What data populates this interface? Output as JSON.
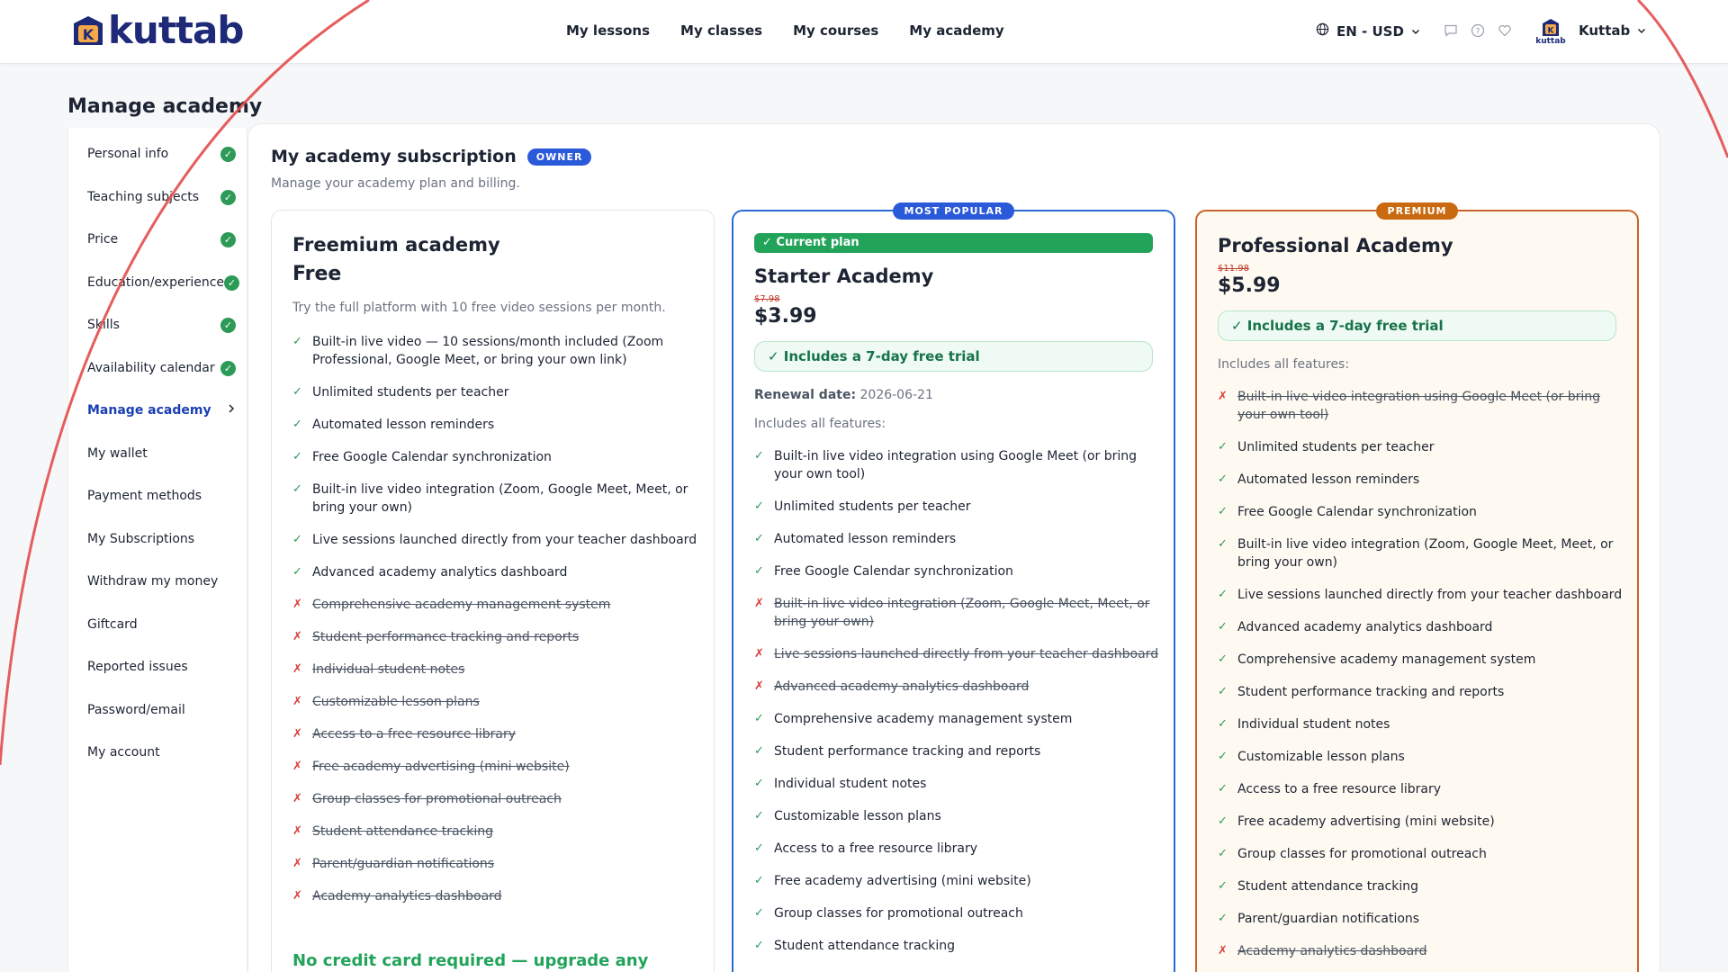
{
  "header": {
    "brand": "kuttab",
    "nav": [
      "My lessons",
      "My classes",
      "My courses",
      "My academy"
    ],
    "locale": "EN - USD",
    "avatar_label": "kuttab",
    "user_name": "Kuttab"
  },
  "page": {
    "title": "Manage academy"
  },
  "sidebar": {
    "items": [
      {
        "label": "Personal info",
        "done": true
      },
      {
        "label": "Teaching subjects",
        "done": true
      },
      {
        "label": "Price",
        "done": true
      },
      {
        "label": "Education/experience",
        "done": true
      },
      {
        "label": "Skills",
        "done": true
      },
      {
        "label": "Availability calendar",
        "done": true
      },
      {
        "label": "Manage academy",
        "active": true
      },
      {
        "label": "My wallet"
      },
      {
        "label": "Payment methods"
      },
      {
        "label": "My Subscriptions"
      },
      {
        "label": "Withdraw my money"
      },
      {
        "label": "Giftcard"
      },
      {
        "label": "Reported issues"
      },
      {
        "label": "Password/email"
      },
      {
        "label": "My account"
      }
    ]
  },
  "subscription": {
    "title": "My academy subscription",
    "owner_badge": "OWNER",
    "subtitle": "Manage your academy plan and billing."
  },
  "plans": {
    "freemium": {
      "name": "Freemium academy",
      "price": "Free",
      "description": "Try the full platform with 10 free video sessions per month.",
      "features": [
        {
          "text": "Built-in live video — 10 sessions/month included (Zoom Professional, Google Meet, or bring your own link)",
          "included": true
        },
        {
          "text": "Unlimited students per teacher",
          "included": true
        },
        {
          "text": "Automated lesson reminders",
          "included": true
        },
        {
          "text": "Free Google Calendar synchronization",
          "included": true
        },
        {
          "text": "Built-in live video integration (Zoom, Google Meet, Meet, or bring your own)",
          "included": true
        },
        {
          "text": "Live sessions launched directly from your teacher dashboard",
          "included": true
        },
        {
          "text": "Advanced academy analytics dashboard",
          "included": true
        },
        {
          "text": "Comprehensive academy management system",
          "included": false
        },
        {
          "text": "Student performance tracking and reports",
          "included": false
        },
        {
          "text": "Individual student notes",
          "included": false
        },
        {
          "text": "Customizable lesson plans",
          "included": false
        },
        {
          "text": "Access to a free resource library",
          "included": false
        },
        {
          "text": "Free academy advertising (mini website)",
          "included": false
        },
        {
          "text": "Group classes for promotional outreach",
          "included": false
        },
        {
          "text": "Student attendance tracking",
          "included": false
        },
        {
          "text": "Parent/guardian notifications",
          "included": false
        },
        {
          "text": "Academy analytics dashboard",
          "included": false
        }
      ],
      "footnote": "No credit card required — upgrade any"
    },
    "starter": {
      "ribbon": "MOST POPULAR",
      "current_label": "✓ Current plan",
      "name": "Starter Academy",
      "old_price": "$7.98",
      "price": "$3.99",
      "trial": "✓ Includes a 7-day free trial",
      "renewal_label": "Renewal date:",
      "renewal_date": "2026-06-21",
      "includes_label": "Includes all features:",
      "features": [
        {
          "text": "Built-in live video integration using Google Meet (or bring your own tool)",
          "included": true
        },
        {
          "text": "Unlimited students per teacher",
          "included": true
        },
        {
          "text": "Automated lesson reminders",
          "included": true
        },
        {
          "text": "Free Google Calendar synchronization",
          "included": true
        },
        {
          "text": "Built-in live video integration (Zoom, Google Meet, Meet, or bring your own)",
          "included": false
        },
        {
          "text": "Live sessions launched directly from your teacher dashboard",
          "included": false
        },
        {
          "text": "Advanced academy analytics dashboard",
          "included": false
        },
        {
          "text": "Comprehensive academy management system",
          "included": true
        },
        {
          "text": "Student performance tracking and reports",
          "included": true
        },
        {
          "text": "Individual student notes",
          "included": true
        },
        {
          "text": "Customizable lesson plans",
          "included": true
        },
        {
          "text": "Access to a free resource library",
          "included": true
        },
        {
          "text": "Free academy advertising (mini website)",
          "included": true
        },
        {
          "text": "Group classes for promotional outreach",
          "included": true
        },
        {
          "text": "Student attendance tracking",
          "included": true
        }
      ]
    },
    "professional": {
      "ribbon": "PREMIUM",
      "name": "Professional Academy",
      "old_price": "$11.98",
      "price": "$5.99",
      "trial": "✓ Includes a 7-day free trial",
      "includes_label": "Includes all features:",
      "features": [
        {
          "text": "Built-in live video integration using Google Meet (or bring your own tool)",
          "included": false
        },
        {
          "text": "Unlimited students per teacher",
          "included": true
        },
        {
          "text": "Automated lesson reminders",
          "included": true
        },
        {
          "text": "Free Google Calendar synchronization",
          "included": true
        },
        {
          "text": "Built-in live video integration (Zoom, Google Meet, Meet, or bring your own)",
          "included": true
        },
        {
          "text": "Live sessions launched directly from your teacher dashboard",
          "included": true
        },
        {
          "text": "Advanced academy analytics dashboard",
          "included": true
        },
        {
          "text": "Comprehensive academy management system",
          "included": true
        },
        {
          "text": "Student performance tracking and reports",
          "included": true
        },
        {
          "text": "Individual student notes",
          "included": true
        },
        {
          "text": "Customizable lesson plans",
          "included": true
        },
        {
          "text": "Access to a free resource library",
          "included": true
        },
        {
          "text": "Free academy advertising (mini website)",
          "included": true
        },
        {
          "text": "Group classes for promotional outreach",
          "included": true
        },
        {
          "text": "Student attendance tracking",
          "included": true
        },
        {
          "text": "Parent/guardian notifications",
          "included": true
        },
        {
          "text": "Academy analytics dashboard",
          "included": false
        }
      ]
    }
  },
  "colors": {
    "brand": "#1e2a78",
    "accent": "#2a59d9",
    "success": "#22a35a",
    "danger": "#d93a3a",
    "premium": "#c96a10"
  },
  "icons": [
    "globe-icon",
    "chevron-down-icon",
    "chat-icon",
    "help-icon",
    "heart-icon",
    "check-circle-icon",
    "chevron-right-icon"
  ]
}
